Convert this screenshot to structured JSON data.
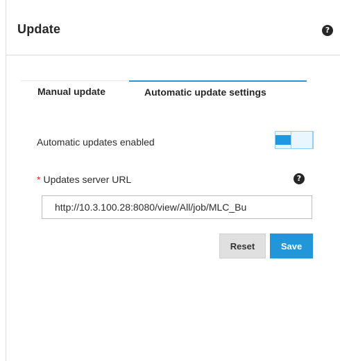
{
  "header": {
    "title": "Update",
    "help_icon": "question-circle-icon"
  },
  "tabs": [
    {
      "label": "Manual update",
      "active": false
    },
    {
      "label": "Automatic update settings",
      "active": true
    }
  ],
  "settings": {
    "auto_updates_label": "Automatic updates enabled",
    "auto_updates_enabled": true,
    "url_label": "Updates server URL",
    "url_required_marker": "*",
    "url_value": "http://10.3.100.28:8080/view/All/job/MLC_Bu",
    "url_help_icon": "question-circle-icon"
  },
  "buttons": {
    "reset_label": "Reset",
    "save_label": "Save"
  },
  "colors": {
    "accent": "#2196d8",
    "required": "#e2231a",
    "toggle_track": "#e6f5fd"
  }
}
